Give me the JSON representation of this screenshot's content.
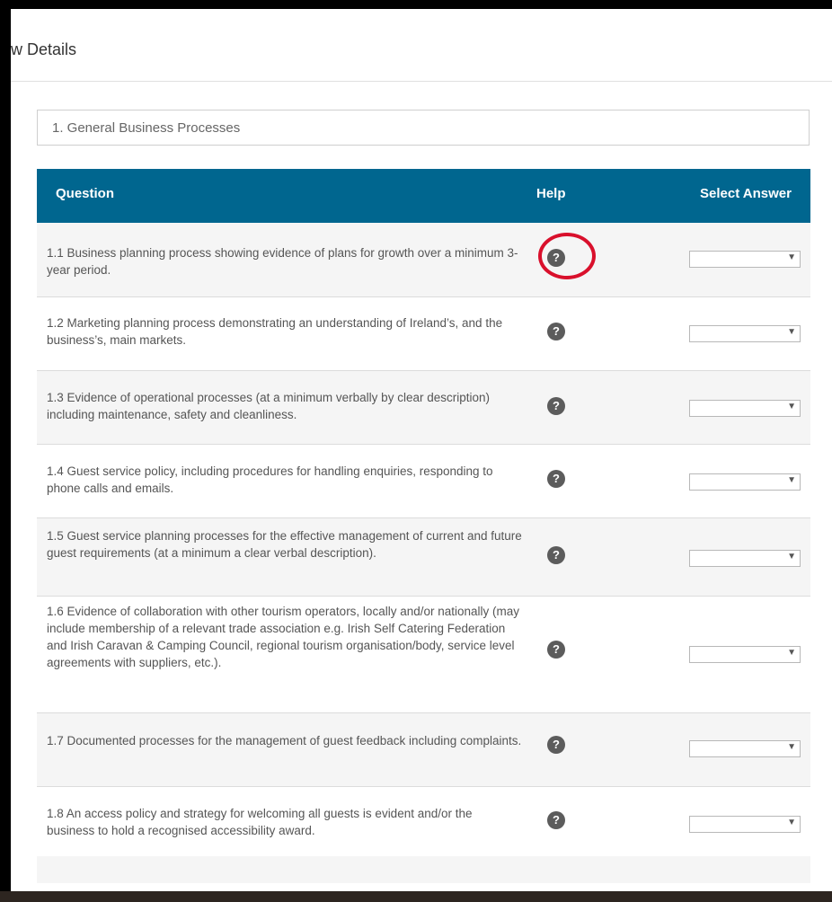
{
  "modal": {
    "title": "w Details"
  },
  "section": {
    "title": "1. General Business Processes"
  },
  "table": {
    "headers": {
      "question": "Question",
      "help": "Help",
      "answer": "Select Answer"
    },
    "rows": [
      {
        "text": "1.1 Business planning process showing evidence of plans for growth over a minimum 3-year period.",
        "selected": ""
      },
      {
        "text": "1.2 Marketing planning process demonstrating an understanding of Ireland’s, and the business’s, main markets.",
        "selected": ""
      },
      {
        "text": "1.3 Evidence of operational processes (at a minimum verbally by clear description) including maintenance, safety and cleanliness.",
        "selected": ""
      },
      {
        "text": "1.4 Guest service policy, including procedures for handling enquiries, responding to phone calls and emails.",
        "selected": ""
      },
      {
        "text": "1.5 Guest service planning processes for the effective management of current and future guest requirements (at a minimum a clear verbal description).",
        "selected": ""
      },
      {
        "text": "1.6 Evidence of collaboration with other tourism operators, locally and/or nationally (may include membership of a relevant trade association e.g. Irish Self Catering Federation and Irish Caravan & Camping Council, regional tourism organisation/body, service level agreements with suppliers, etc.).",
        "selected": ""
      },
      {
        "text": "1.7 Documented processes for the management of guest feedback including complaints.",
        "selected": ""
      },
      {
        "text": "1.8 An access policy and strategy for welcoming all guests is evident and/or the business to hold a recognised accessibility award.",
        "selected": ""
      }
    ]
  },
  "icons": {
    "help": "question-circle-icon",
    "dropdown": "chevron-down-icon",
    "help_glyph": "?",
    "dropdown_glyph": "▼"
  },
  "colors": {
    "header_bg": "#00668f",
    "highlight": "#d9102c",
    "help_icon": "#5c5c5c"
  }
}
